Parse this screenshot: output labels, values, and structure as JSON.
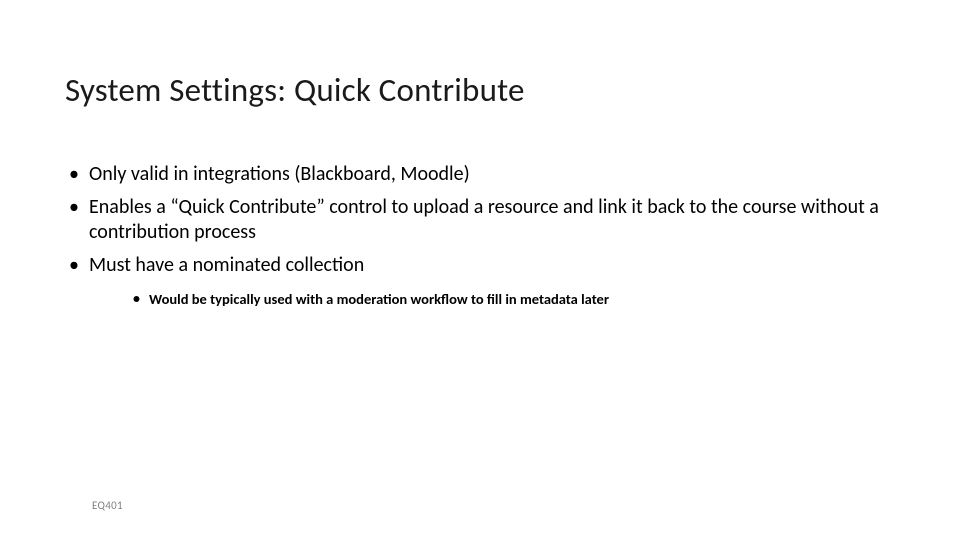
{
  "slide": {
    "title": "System Settings: Quick Contribute",
    "bullets": [
      "Only valid in integrations (Blackboard, Moodle)",
      "Enables a “Quick Contribute” control to upload a resource and link it back to the course without a contribution process",
      "Must have a nominated collection"
    ],
    "sub_bullets": [
      "Would be typically used with a moderation workflow to fill in metadata later"
    ],
    "footer": "EQ401"
  }
}
